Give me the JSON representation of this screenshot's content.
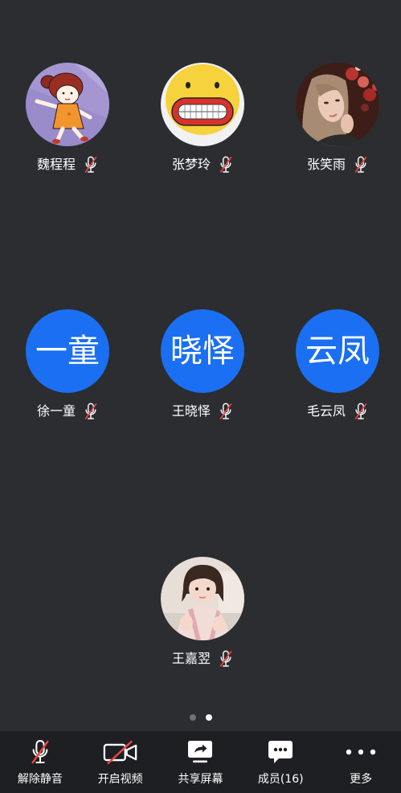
{
  "colors": {
    "background": "#2b2d31",
    "toolbar": "#1e1f22",
    "avatar_blue": "#1b6ff2",
    "muted_red": "#ef4444"
  },
  "participants": [
    {
      "name": "魏程程",
      "muted": true,
      "mic_icon": "mic-muted-icon"
    },
    {
      "name": "张梦玲",
      "muted": true,
      "mic_icon": "mic-muted-icon"
    },
    {
      "name": "张笑雨",
      "muted": true,
      "mic_icon": "mic-muted-icon"
    },
    {
      "name": "徐一童",
      "initials": "一童",
      "muted": true,
      "mic_icon": "mic-muted-icon"
    },
    {
      "name": "王晓怿",
      "initials": "晓怿",
      "muted": true,
      "mic_icon": "mic-muted-icon"
    },
    {
      "name": "毛云凤",
      "initials": "云凤",
      "muted": true,
      "mic_icon": "mic-muted-icon"
    },
    {
      "name": "王嘉翌",
      "muted": true,
      "mic_icon": "mic-muted-icon"
    }
  ],
  "pagination": {
    "total_pages": 2,
    "current_page": 2
  },
  "toolbar": {
    "items": [
      {
        "label": "解除静音",
        "icon": "mic-muted-icon"
      },
      {
        "label": "开启视频",
        "icon": "video-off-icon"
      },
      {
        "label": "共享屏幕",
        "icon": "share-screen-icon"
      },
      {
        "label": "成员(16)",
        "icon": "members-icon"
      },
      {
        "label": "更多",
        "icon": "more-icon"
      }
    ]
  }
}
